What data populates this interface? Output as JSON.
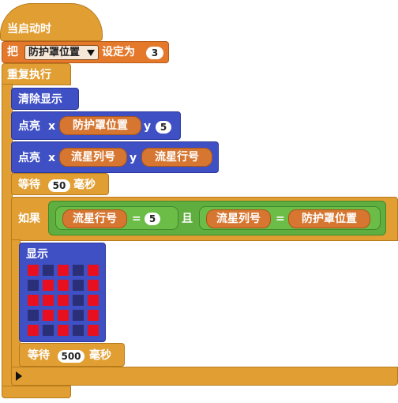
{
  "hat": {
    "label": "当启动时"
  },
  "set_block": {
    "verb": "把",
    "variable": "防护罩位置",
    "dropdown_icon": "triangle-down-icon",
    "suffix": "设定为",
    "value": "3"
  },
  "forever": {
    "label": "重复执行"
  },
  "clear": {
    "label": "清除显示"
  },
  "plot1": {
    "label": "点亮",
    "x_label": "x",
    "x_reporter": "防护罩位置",
    "y_label": "y",
    "y_value": "5"
  },
  "plot2": {
    "label": "点亮",
    "x_label": "x",
    "x_reporter": "流星列号",
    "y_label": "y",
    "y_reporter": "流星行号"
  },
  "wait1": {
    "label": "等待",
    "value": "50",
    "unit": "毫秒"
  },
  "if_block": {
    "label": "如果",
    "left": {
      "reporter": "流星行号",
      "op": "=",
      "value": "5"
    },
    "joiner": "且",
    "right": {
      "reporter": "流星列号",
      "op": "=",
      "value_reporter": "防护罩位置"
    }
  },
  "show": {
    "label": "显示",
    "grid": [
      [
        1,
        0,
        1,
        0,
        1
      ],
      [
        0,
        1,
        1,
        0,
        1
      ],
      [
        1,
        1,
        1,
        0,
        1
      ],
      [
        0,
        1,
        1,
        0,
        1
      ],
      [
        1,
        0,
        1,
        0,
        1
      ]
    ],
    "on_color": "#e8101e",
    "off_color": "#2a2f78"
  },
  "wait2": {
    "label": "等待",
    "value": "500",
    "unit": "毫秒"
  },
  "colors": {
    "control": "#e19f33",
    "variable": "#e4792c",
    "display": "#3f4fc4",
    "operator": "#5fae3f"
  }
}
